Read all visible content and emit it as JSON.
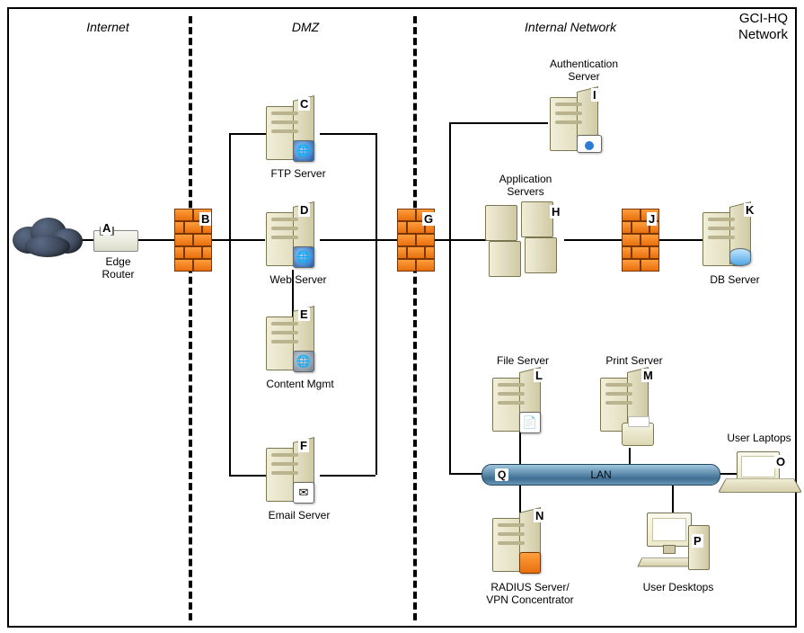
{
  "diagram_title": {
    "line1": "GCI-HQ",
    "line2": "Network"
  },
  "zones": {
    "internet": "Internet",
    "dmz": "DMZ",
    "internal": "Internal Network"
  },
  "lan_label": "LAN",
  "nodes": {
    "A": {
      "tag": "A",
      "label": "Edge\nRouter",
      "zone": "Internet",
      "type": "router"
    },
    "B": {
      "tag": "B",
      "label": "",
      "zone": "boundary",
      "type": "firewall"
    },
    "C": {
      "tag": "C",
      "label": "FTP Server",
      "zone": "DMZ",
      "type": "server",
      "badge": "globe-doc"
    },
    "D": {
      "tag": "D",
      "label": "Web Server",
      "zone": "DMZ",
      "type": "server",
      "badge": "globe"
    },
    "E": {
      "tag": "E",
      "label": "Content Mgmt",
      "zone": "DMZ",
      "type": "server",
      "badge": "globe"
    },
    "F": {
      "tag": "F",
      "label": "Email Server",
      "zone": "DMZ",
      "type": "server",
      "badge": "mail"
    },
    "G": {
      "tag": "G",
      "label": "",
      "zone": "boundary",
      "type": "firewall"
    },
    "H": {
      "tag": "H",
      "label": "Application\nServers",
      "zone": "Internal",
      "type": "server-cluster"
    },
    "I": {
      "tag": "I",
      "label": "Authentication\nServer",
      "zone": "Internal",
      "type": "server",
      "badge": "card"
    },
    "J": {
      "tag": "J",
      "label": "",
      "zone": "Internal",
      "type": "firewall"
    },
    "K": {
      "tag": "K",
      "label": "DB Server",
      "zone": "Internal",
      "type": "server",
      "badge": "disk"
    },
    "L": {
      "tag": "L",
      "label": "File Server",
      "zone": "Internal",
      "type": "server",
      "badge": "doc"
    },
    "M": {
      "tag": "M",
      "label": "Print Server",
      "zone": "Internal",
      "type": "server",
      "badge": "printer"
    },
    "N": {
      "tag": "N",
      "label": "RADIUS Server/\nVPN Concentrator",
      "zone": "Internal",
      "type": "server",
      "badge": "fw"
    },
    "O": {
      "tag": "O",
      "label": "User Laptops",
      "zone": "Internal",
      "type": "laptop"
    },
    "P": {
      "tag": "P",
      "label": "User Desktops",
      "zone": "Internal",
      "type": "desktop"
    },
    "Q": {
      "tag": "Q",
      "label": "LAN",
      "zone": "Internal",
      "type": "lan-bus"
    }
  },
  "connections": [
    [
      "cloud",
      "A"
    ],
    [
      "A",
      "B"
    ],
    [
      "B",
      "C"
    ],
    [
      "B",
      "D"
    ],
    [
      "B",
      "F"
    ],
    [
      "D",
      "E"
    ],
    [
      "C",
      "G"
    ],
    [
      "D",
      "G"
    ],
    [
      "F",
      "G"
    ],
    [
      "G",
      "H"
    ],
    [
      "G",
      "I"
    ],
    [
      "G",
      "Q"
    ],
    [
      "H",
      "J"
    ],
    [
      "J",
      "K"
    ],
    [
      "Q",
      "L"
    ],
    [
      "Q",
      "M"
    ],
    [
      "Q",
      "N"
    ],
    [
      "Q",
      "O"
    ],
    [
      "Q",
      "P"
    ]
  ]
}
